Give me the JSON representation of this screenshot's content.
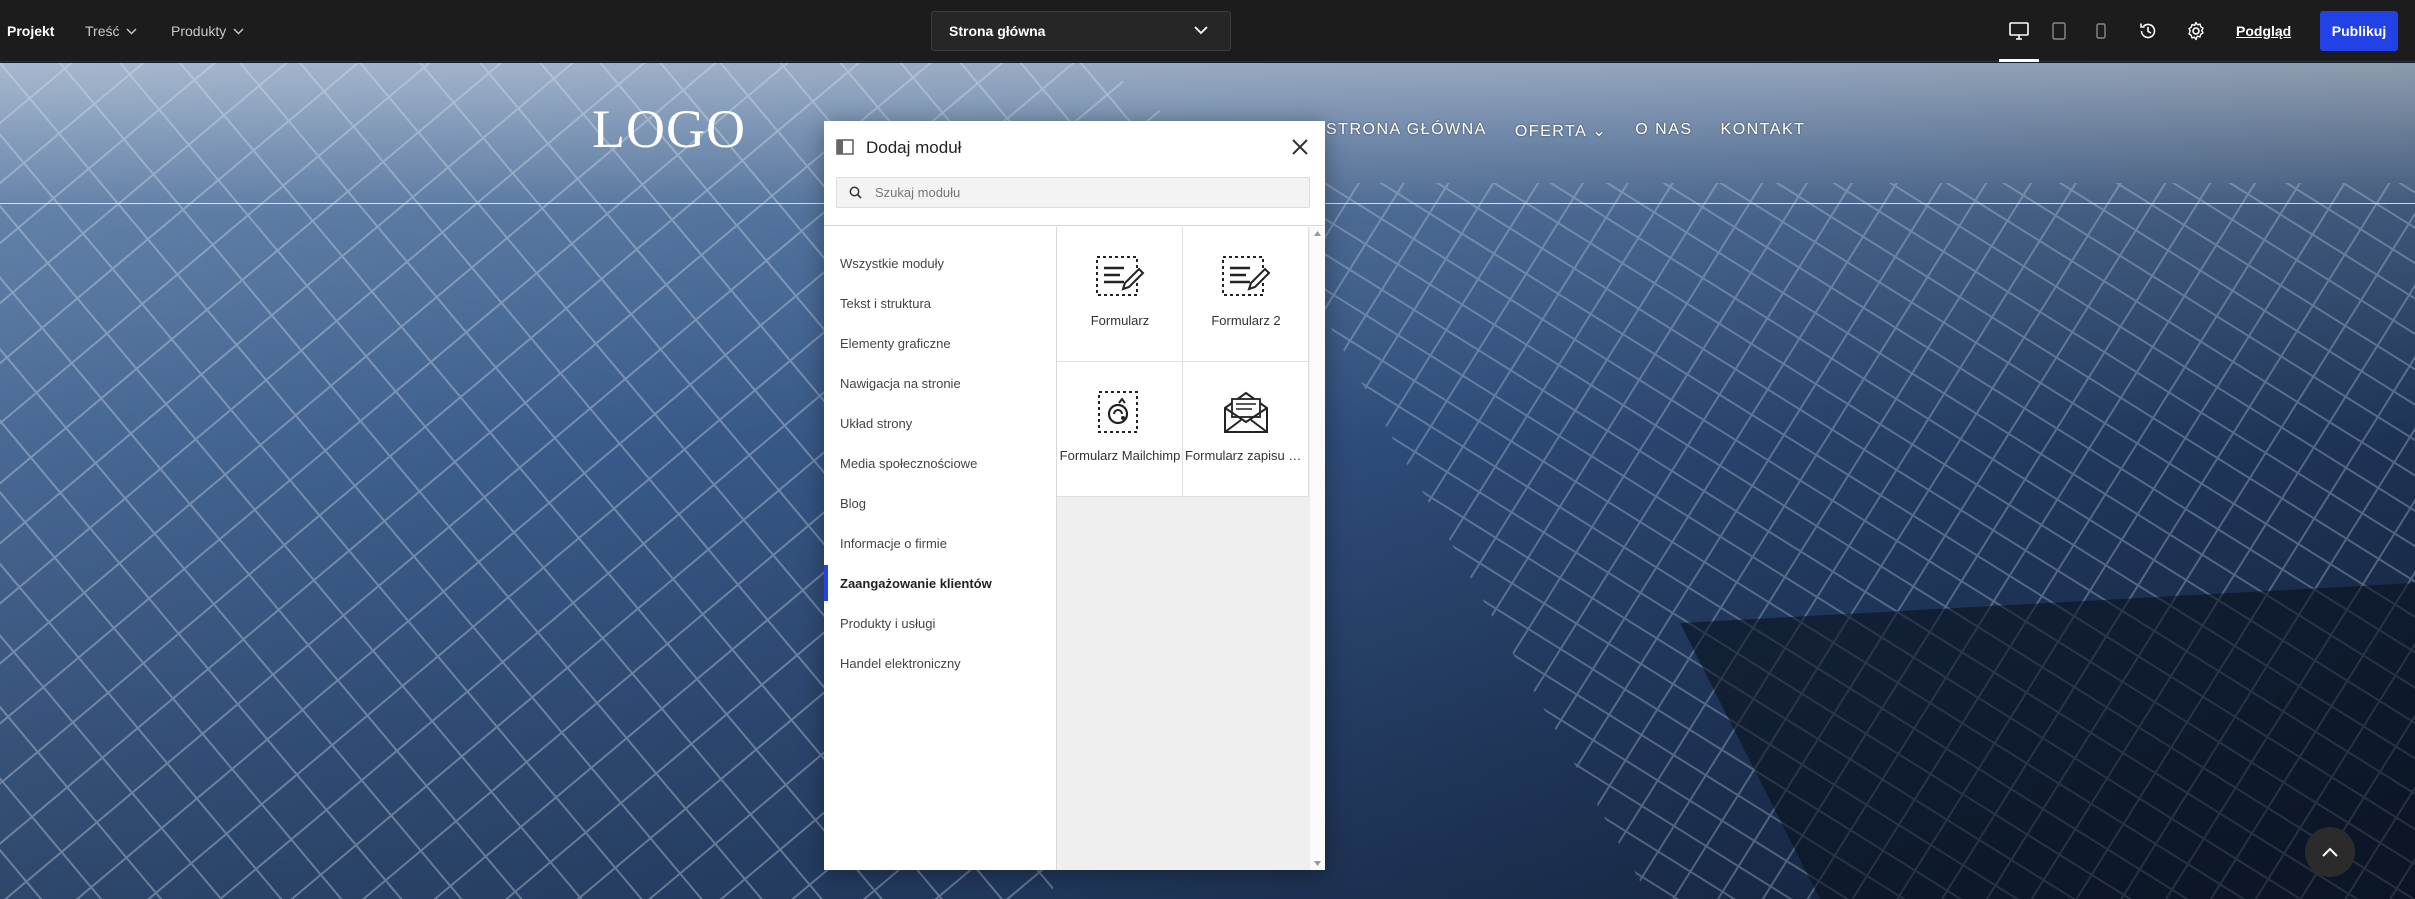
{
  "toolbar": {
    "project_label": "Projekt",
    "content_menu": "Treść",
    "products_menu": "Produkty",
    "page_selector": "Strona główna",
    "preview_label": "Podgląd",
    "publish_label": "Publikuj"
  },
  "site": {
    "logo": "LOGO",
    "nav": [
      "STRONA GŁÓWNA",
      "OFERTA ⌄",
      "O NAS",
      "KONTAKT"
    ]
  },
  "modal": {
    "title": "Dodaj moduł",
    "search_placeholder": "Szukaj modułu",
    "categories": [
      "Wszystkie moduły",
      "Tekst i struktura",
      "Elementy graficzne",
      "Nawigacja na stronie",
      "Układ strony",
      "Media społecznościowe",
      "Blog",
      "Informacje o firmie",
      "Zaangażowanie klientów",
      "Produkty i usługi",
      "Handel elektroniczny"
    ],
    "active_category": "Zaangażowanie klientów",
    "modules": [
      {
        "label": "Formularz",
        "icon": "form-edit-icon"
      },
      {
        "label": "Formularz 2",
        "icon": "form-edit-icon"
      },
      {
        "label": "Formularz Mailchimp",
        "icon": "mailchimp-icon"
      },
      {
        "label": "Formularz zapisu do newslettera",
        "icon": "envelope-icon"
      }
    ]
  },
  "colors": {
    "accent": "#2241e6",
    "toolbar_bg": "#1c1c1c"
  }
}
